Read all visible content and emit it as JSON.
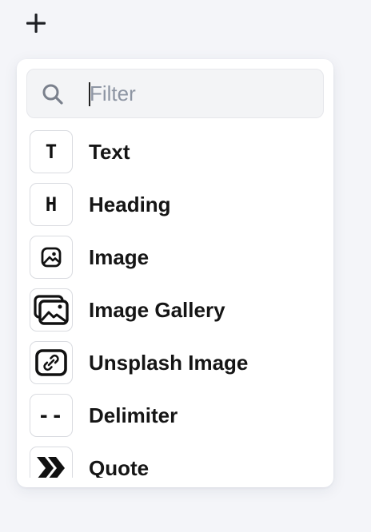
{
  "toolbar": {
    "add_icon": "plus-icon"
  },
  "filter": {
    "placeholder": "Filter",
    "value": "",
    "icon": "search-icon"
  },
  "blocks": [
    {
      "label": "Text",
      "icon": "text-icon",
      "glyph": "T"
    },
    {
      "label": "Heading",
      "icon": "heading-icon",
      "glyph": "H"
    },
    {
      "label": "Image",
      "icon": "image-icon"
    },
    {
      "label": "Image Gallery",
      "icon": "image-gallery-icon"
    },
    {
      "label": "Unsplash Image",
      "icon": "unsplash-link-icon"
    },
    {
      "label": "Delimiter",
      "icon": "delimiter-icon",
      "glyph": "--"
    },
    {
      "label": "Quote",
      "icon": "quote-icon"
    }
  ]
}
